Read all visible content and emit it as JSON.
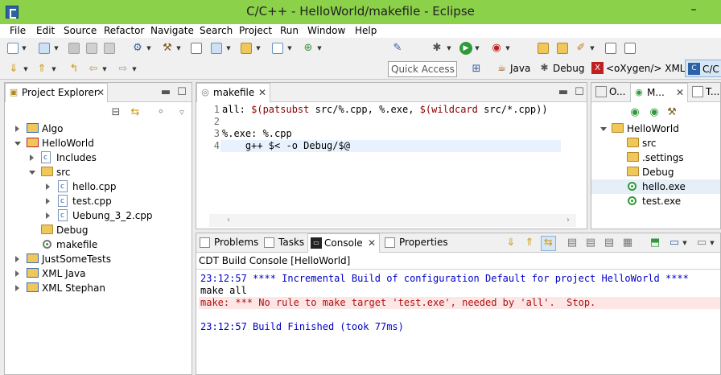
{
  "window": {
    "title": "C/C++ - HelloWorld/makefile - Eclipse",
    "minimize": "–"
  },
  "menu": [
    "File",
    "Edit",
    "Source",
    "Refactor",
    "Navigate",
    "Search",
    "Project",
    "Run",
    "Window",
    "Help"
  ],
  "quick_access": {
    "placeholder": "Quick Access"
  },
  "perspectives": [
    {
      "label": "Java",
      "icon": "java-perspective-icon"
    },
    {
      "label": "Debug",
      "icon": "bug-icon"
    },
    {
      "label": "<oXygen/> XML",
      "icon": "oxygen-icon"
    },
    {
      "label": "C/C",
      "icon": "cpp-perspective-icon"
    }
  ],
  "project_explorer": {
    "title": "Project Explorer",
    "items": [
      {
        "label": "Algo"
      },
      {
        "label": "HelloWorld"
      },
      {
        "label": "Includes"
      },
      {
        "label": "src"
      },
      {
        "label": "hello.cpp"
      },
      {
        "label": "test.cpp"
      },
      {
        "label": "Uebung_3_2.cpp"
      },
      {
        "label": "Debug"
      },
      {
        "label": "makefile"
      },
      {
        "label": "JustSomeTests"
      },
      {
        "label": "XML Java"
      },
      {
        "label": "XML Stephan"
      }
    ]
  },
  "editor": {
    "tab": "makefile",
    "lines": [
      {
        "n": "1",
        "text": "all: $(patsubst src/%.cpp, %.exe, $(wildcard src/*.cpp))"
      },
      {
        "n": "2",
        "text": ""
      },
      {
        "n": "3",
        "text": "%.exe: %.cpp"
      },
      {
        "n": "4",
        "text": "    g++ $< -o Debug/$@"
      }
    ]
  },
  "outline_view": {
    "tabs": [
      "O...",
      "M...",
      "T..."
    ],
    "items": [
      {
        "label": "HelloWorld"
      },
      {
        "label": "src"
      },
      {
        "label": ".settings"
      },
      {
        "label": "Debug"
      },
      {
        "label": "hello.exe"
      },
      {
        "label": "test.exe"
      }
    ]
  },
  "console_view": {
    "tabs": [
      "Problems",
      "Tasks",
      "Console",
      "Properties"
    ],
    "header": "CDT Build Console [HelloWorld]",
    "lines": [
      {
        "text": "23:12:57 **** Incremental Build of configuration Default for project HelloWorld ****",
        "color": "#0000c8"
      },
      {
        "text": "make all",
        "color": "#000000"
      },
      {
        "text": "make: *** No rule to make target 'test.exe', needed by 'all'.  Stop.",
        "color": "#b01010",
        "bg": "#fde6e6"
      },
      {
        "text": "",
        "color": "#000000"
      },
      {
        "text": "23:12:57 Build Finished (took 77ms)",
        "color": "#0000c8"
      }
    ]
  },
  "colors": {
    "titlebar": "#8bd14a",
    "console_info": "#0000c8",
    "console_error": "#b01010",
    "error_bg": "#fde6e6",
    "current_line": "#e8f2fe"
  }
}
